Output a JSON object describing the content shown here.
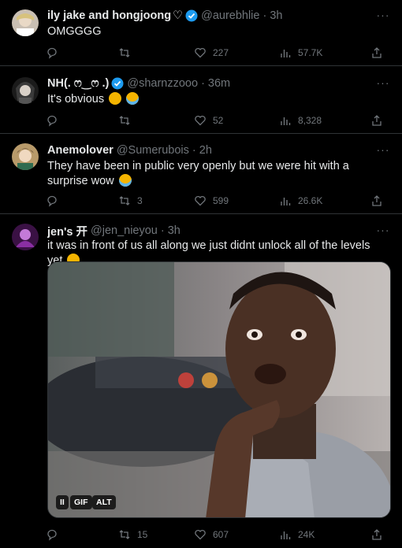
{
  "tweets": [
    {
      "name": "ily jake and hongjoong",
      "heart_emoji": "♡",
      "handle": "@aurebhlie · 3h",
      "text": "OMGGGG",
      "replies": "",
      "retweets": "",
      "likes": "227",
      "views": "57.7K",
      "verified": true
    },
    {
      "name": "NH(. ෆ‿ෆ .)",
      "handle": "@sharnzzooo · 36m",
      "text": "It's obvious",
      "replies": "",
      "retweets": "",
      "likes": "52",
      "views": "8,328",
      "verified": true
    },
    {
      "name": "Anemolover",
      "handle": "@Sumerubois · 2h",
      "text": "They have been in public very openly but we were hit with a surprise wow",
      "replies": "",
      "retweets": "3",
      "likes": "599",
      "views": "26.6K",
      "verified": false
    },
    {
      "name": "jen's 开",
      "handle": "@jen_nieyou · 3h",
      "text": "it was in front of us all along we just didnt unlock all of the levels yet",
      "replies": "",
      "retweets": "15",
      "likes": "607",
      "views": "24K",
      "verified": false
    }
  ],
  "media": {
    "pause_label": "II",
    "gif_label": "GIF",
    "alt_label": "ALT"
  },
  "more_glyph": "···",
  "colors": {
    "background": "#000000",
    "text": "#e7e9ea",
    "muted": "#71767b",
    "divider": "#2f3336",
    "verified": "#1d9bf0"
  }
}
